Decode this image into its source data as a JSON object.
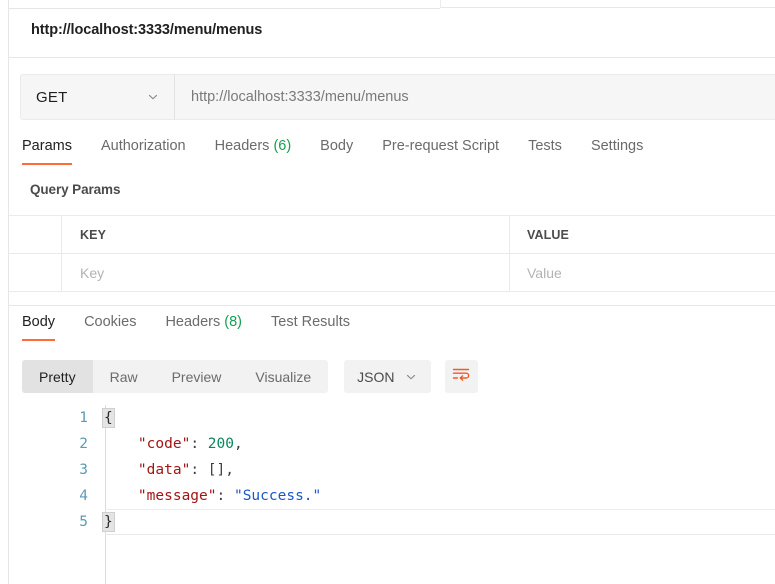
{
  "request": {
    "title": "http://localhost:3333/menu/menus",
    "method": "GET",
    "url_value": "http://localhost:3333/menu/menus",
    "tabs": [
      {
        "label": "Params",
        "count": "",
        "active": true
      },
      {
        "label": "Authorization",
        "count": "",
        "active": false
      },
      {
        "label": "Headers",
        "count": "(6)",
        "active": false
      },
      {
        "label": "Body",
        "count": "",
        "active": false
      },
      {
        "label": "Pre-request Script",
        "count": "",
        "active": false
      },
      {
        "label": "Tests",
        "count": "",
        "active": false
      },
      {
        "label": "Settings",
        "count": "",
        "active": false
      }
    ],
    "query_params_label": "Query Params",
    "table": {
      "headers": {
        "key": "KEY",
        "value": "VALUE"
      },
      "rows": [
        {
          "key_placeholder": "Key",
          "value_placeholder": "Value"
        }
      ]
    }
  },
  "response": {
    "tabs": [
      {
        "label": "Body",
        "count": "",
        "active": true
      },
      {
        "label": "Cookies",
        "count": "",
        "active": false
      },
      {
        "label": "Headers",
        "count": "(8)",
        "active": false
      },
      {
        "label": "Test Results",
        "count": "",
        "active": false
      }
    ],
    "view_modes": [
      {
        "label": "Pretty",
        "active": true
      },
      {
        "label": "Raw",
        "active": false
      },
      {
        "label": "Preview",
        "active": false
      },
      {
        "label": "Visualize",
        "active": false
      }
    ],
    "format": "JSON",
    "body_lines": [
      {
        "number": "1",
        "tokens": [
          {
            "t": "{",
            "c": "k-brace"
          }
        ]
      },
      {
        "number": "2",
        "tokens": [
          {
            "t": "    ",
            "c": "k-punc"
          },
          {
            "t": "\"code\"",
            "c": "k-key"
          },
          {
            "t": ": ",
            "c": "k-punc"
          },
          {
            "t": "200",
            "c": "k-num"
          },
          {
            "t": ",",
            "c": "k-punc"
          }
        ]
      },
      {
        "number": "3",
        "tokens": [
          {
            "t": "    ",
            "c": "k-punc"
          },
          {
            "t": "\"data\"",
            "c": "k-key"
          },
          {
            "t": ": [],",
            "c": "k-punc"
          }
        ]
      },
      {
        "number": "4",
        "tokens": [
          {
            "t": "    ",
            "c": "k-punc"
          },
          {
            "t": "\"message\"",
            "c": "k-key"
          },
          {
            "t": ": ",
            "c": "k-punc"
          },
          {
            "t": "\"Success.\"",
            "c": "k-str"
          }
        ]
      },
      {
        "number": "5",
        "tokens": [
          {
            "t": "}",
            "c": "k-brace"
          }
        ]
      }
    ]
  },
  "colors": {
    "accent": "#ff6c37",
    "count_green": "#12a150",
    "json_key": "#a31515",
    "json_number": "#09885a",
    "json_string": "#1a57c8",
    "gutter": "#5a9bb5"
  },
  "icons": {
    "method_chevron": "chevron-down-icon",
    "format_chevron": "chevron-down-icon",
    "wrap": "wrap-lines-icon"
  }
}
